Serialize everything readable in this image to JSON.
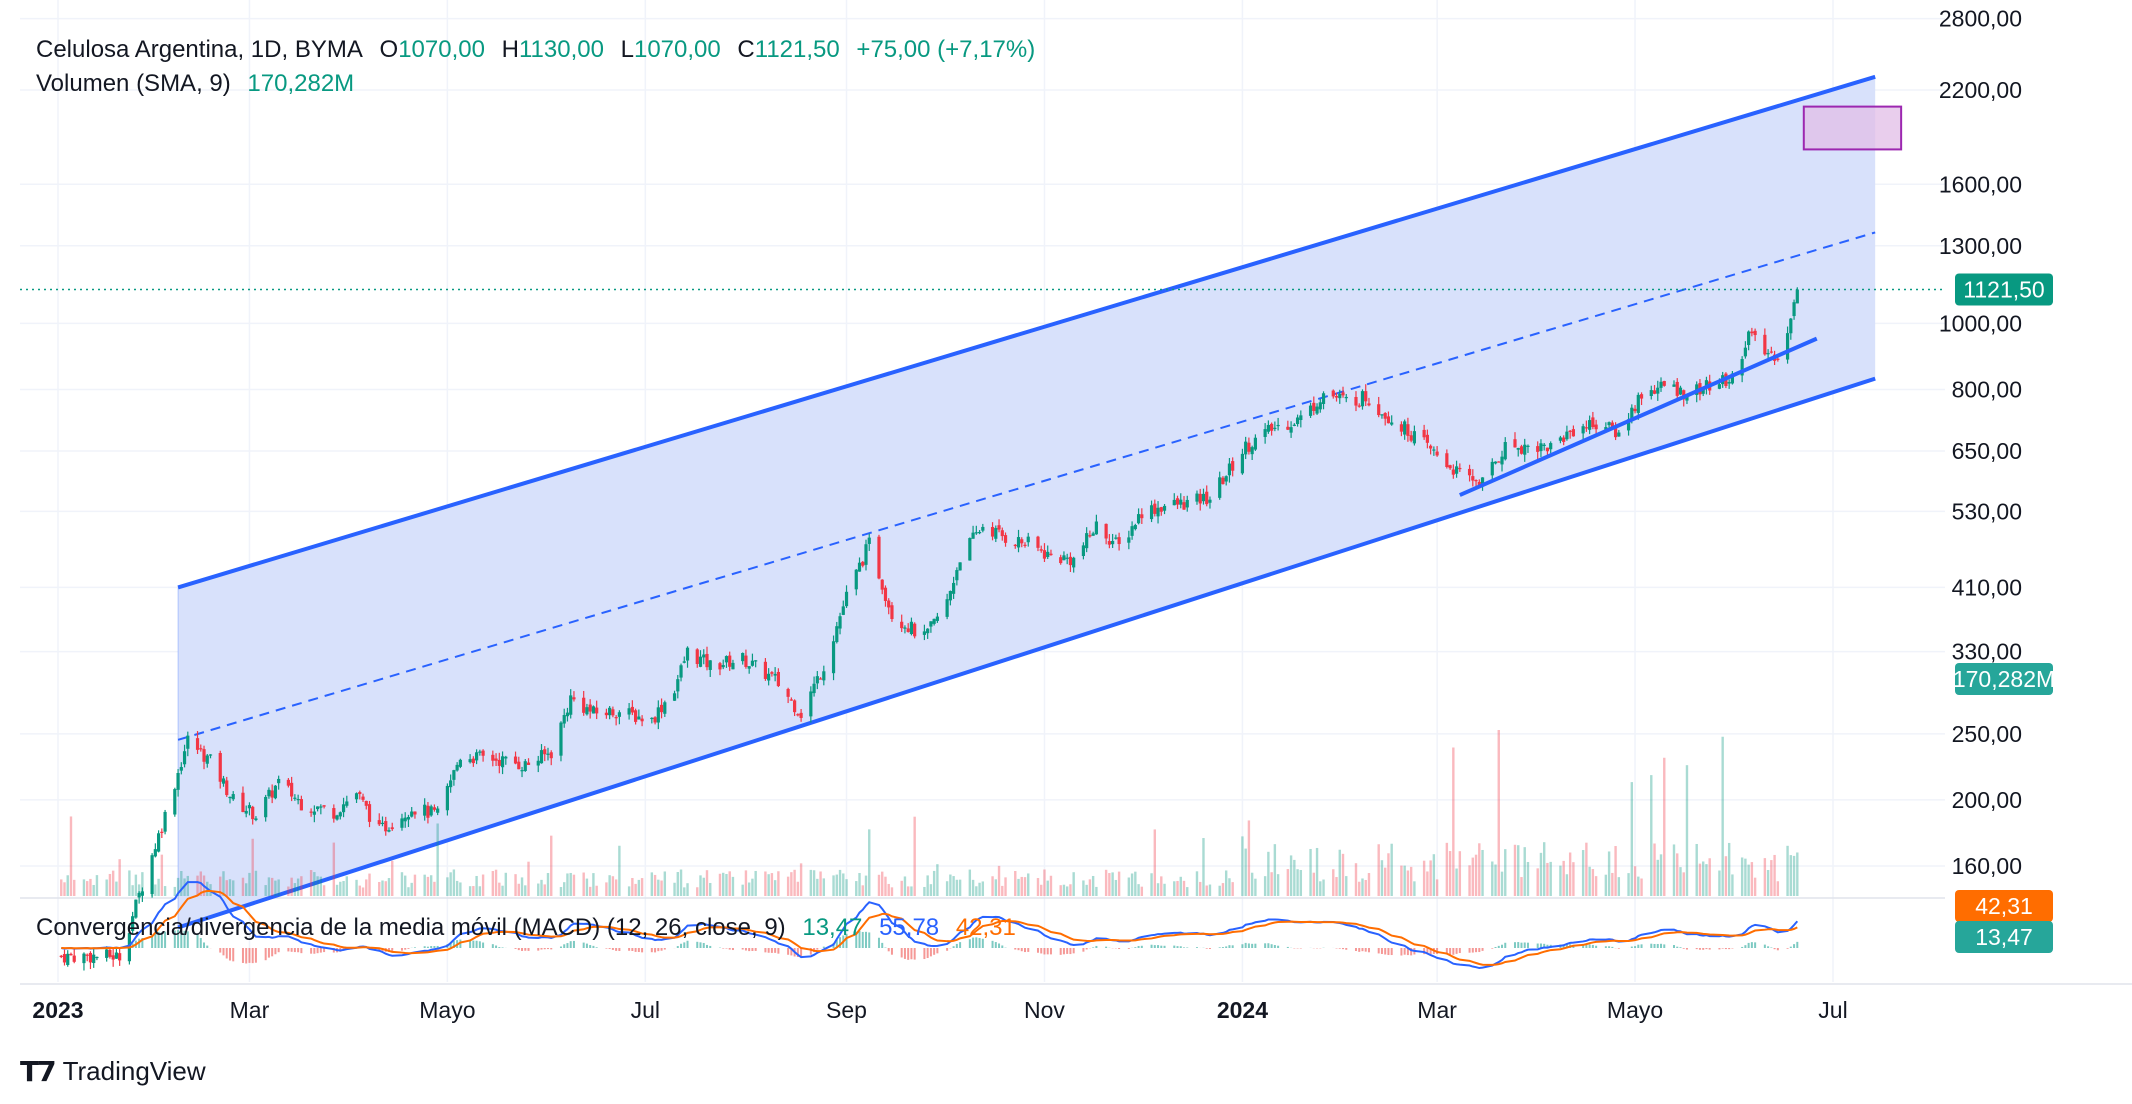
{
  "header": {
    "symbol": "Celulosa Argentina, 1D, BYMA",
    "open_label": "O",
    "open": "1070,00",
    "high_label": "H",
    "high": "1130,00",
    "low_label": "L",
    "low": "1070,00",
    "close_label": "C",
    "close": "1121,50",
    "change": "+75,00 (+7,17%)",
    "volume_label": "Volumen (SMA, 9)",
    "volume_value": "170,282M"
  },
  "macd_legend": {
    "label": "Convergencia/divergencia de la media móvil (MACD) (12, 26, close, 9)",
    "hist": "13,47",
    "macd": "55,78",
    "signal": "42,31"
  },
  "price_tags": {
    "last": "1121,50",
    "volume": "170,282M",
    "signal": "42,31",
    "hist": "13,47"
  },
  "branding": {
    "text": "TradingView"
  },
  "colors": {
    "up": "#089981",
    "down": "#f23645",
    "channel": "#2962ff",
    "channel_fill": "#d6dffb",
    "macd": "#2962ff",
    "signal": "#ff6d00",
    "target_box": "#9c27b0"
  },
  "chart_data": {
    "type": "candlestick",
    "scale": "log",
    "y_ticks": [
      "2800,00",
      "2200,00",
      "1600,00",
      "1300,00",
      "1000,00",
      "800,00",
      "650,00",
      "530,00",
      "410,00",
      "330,00",
      "250,00",
      "200,00",
      "160,00"
    ],
    "y_tick_values": [
      2800,
      2200,
      1600,
      1300,
      1000,
      800,
      650,
      530,
      410,
      330,
      250,
      200,
      160
    ],
    "x_ticks": [
      {
        "label": "2023",
        "bold": true,
        "date": "2023-01-01"
      },
      {
        "label": "Mar",
        "bold": false,
        "date": "2023-03-01"
      },
      {
        "label": "Mayo",
        "bold": false,
        "date": "2023-05-01"
      },
      {
        "label": "Jul",
        "bold": false,
        "date": "2023-07-01"
      },
      {
        "label": "Sep",
        "bold": false,
        "date": "2023-09-01"
      },
      {
        "label": "Nov",
        "bold": false,
        "date": "2023-11-01"
      },
      {
        "label": "2024",
        "bold": true,
        "date": "2024-01-01"
      },
      {
        "label": "Mar",
        "bold": false,
        "date": "2024-03-01"
      },
      {
        "label": "Mayo",
        "bold": false,
        "date": "2024-05-01"
      },
      {
        "label": "Jul",
        "bold": false,
        "date": "2024-07-01"
      }
    ],
    "price_anchors": [
      [
        "2023-01-02",
        118
      ],
      [
        "2023-01-20",
        118
      ],
      [
        "2023-01-27",
        150
      ],
      [
        "2023-02-03",
        190
      ],
      [
        "2023-02-10",
        245
      ],
      [
        "2023-02-17",
        228
      ],
      [
        "2023-02-24",
        200
      ],
      [
        "2023-03-03",
        190
      ],
      [
        "2023-03-10",
        212
      ],
      [
        "2023-03-17",
        198
      ],
      [
        "2023-03-27",
        192
      ],
      [
        "2023-04-03",
        205
      ],
      [
        "2023-04-10",
        180
      ],
      [
        "2023-04-20",
        195
      ],
      [
        "2023-04-28",
        190
      ],
      [
        "2023-05-05",
        232
      ],
      [
        "2023-05-15",
        230
      ],
      [
        "2023-05-25",
        225
      ],
      [
        "2023-06-02",
        235
      ],
      [
        "2023-06-08",
        282
      ],
      [
        "2023-06-15",
        268
      ],
      [
        "2023-06-22",
        270
      ],
      [
        "2023-07-03",
        262
      ],
      [
        "2023-07-10",
        292
      ],
      [
        "2023-07-14",
        330
      ],
      [
        "2023-07-21",
        315
      ],
      [
        "2023-07-31",
        322
      ],
      [
        "2023-08-10",
        300
      ],
      [
        "2023-08-18",
        268
      ],
      [
        "2023-08-25",
        315
      ],
      [
        "2023-09-01",
        398
      ],
      [
        "2023-09-08",
        475
      ],
      [
        "2023-09-15",
        375
      ],
      [
        "2023-09-25",
        345
      ],
      [
        "2023-10-02",
        390
      ],
      [
        "2023-10-06",
        455
      ],
      [
        "2023-10-13",
        505
      ],
      [
        "2023-10-20",
        485
      ],
      [
        "2023-10-27",
        475
      ],
      [
        "2023-11-03",
        455
      ],
      [
        "2023-11-10",
        450
      ],
      [
        "2023-11-17",
        505
      ],
      [
        "2023-11-24",
        470
      ],
      [
        "2023-12-01",
        530
      ],
      [
        "2023-12-08",
        540
      ],
      [
        "2023-12-15",
        545
      ],
      [
        "2023-12-22",
        555
      ],
      [
        "2024-01-02",
        660
      ],
      [
        "2024-01-10",
        700
      ],
      [
        "2024-01-20",
        730
      ],
      [
        "2024-01-26",
        790
      ],
      [
        "2024-02-02",
        770
      ],
      [
        "2024-02-08",
        780
      ],
      [
        "2024-02-15",
        730
      ],
      [
        "2024-02-22",
        690
      ],
      [
        "2024-03-01",
        640
      ],
      [
        "2024-03-08",
        600
      ],
      [
        "2024-03-15",
        585
      ],
      [
        "2024-03-22",
        660
      ],
      [
        "2024-03-29",
        660
      ],
      [
        "2024-04-05",
        660
      ],
      [
        "2024-04-12",
        700
      ],
      [
        "2024-04-19",
        715
      ],
      [
        "2024-04-26",
        690
      ],
      [
        "2024-05-03",
        790
      ],
      [
        "2024-05-10",
        810
      ],
      [
        "2024-05-17",
        790
      ],
      [
        "2024-05-24",
        810
      ],
      [
        "2024-05-31",
        830
      ],
      [
        "2024-06-05",
        965
      ],
      [
        "2024-06-10",
        905
      ],
      [
        "2024-06-14",
        900
      ],
      [
        "2024-06-18",
        1010
      ],
      [
        "2024-06-20",
        1121.5
      ]
    ],
    "channel": {
      "start_date": "2023-02-07",
      "end_date": "2024-07-14",
      "upper": [
        410,
        2300
      ],
      "lower": [
        130,
        830
      ],
      "mid": [
        245,
        1360
      ]
    },
    "support_line": {
      "start": [
        "2024-03-08",
        560
      ],
      "end": [
        "2024-06-26",
        950
      ]
    },
    "target_box": {
      "start_date": "2024-06-22",
      "end_date": "2024-07-22",
      "top": 2080,
      "bottom": 1800
    },
    "last_price": 1121.5
  }
}
